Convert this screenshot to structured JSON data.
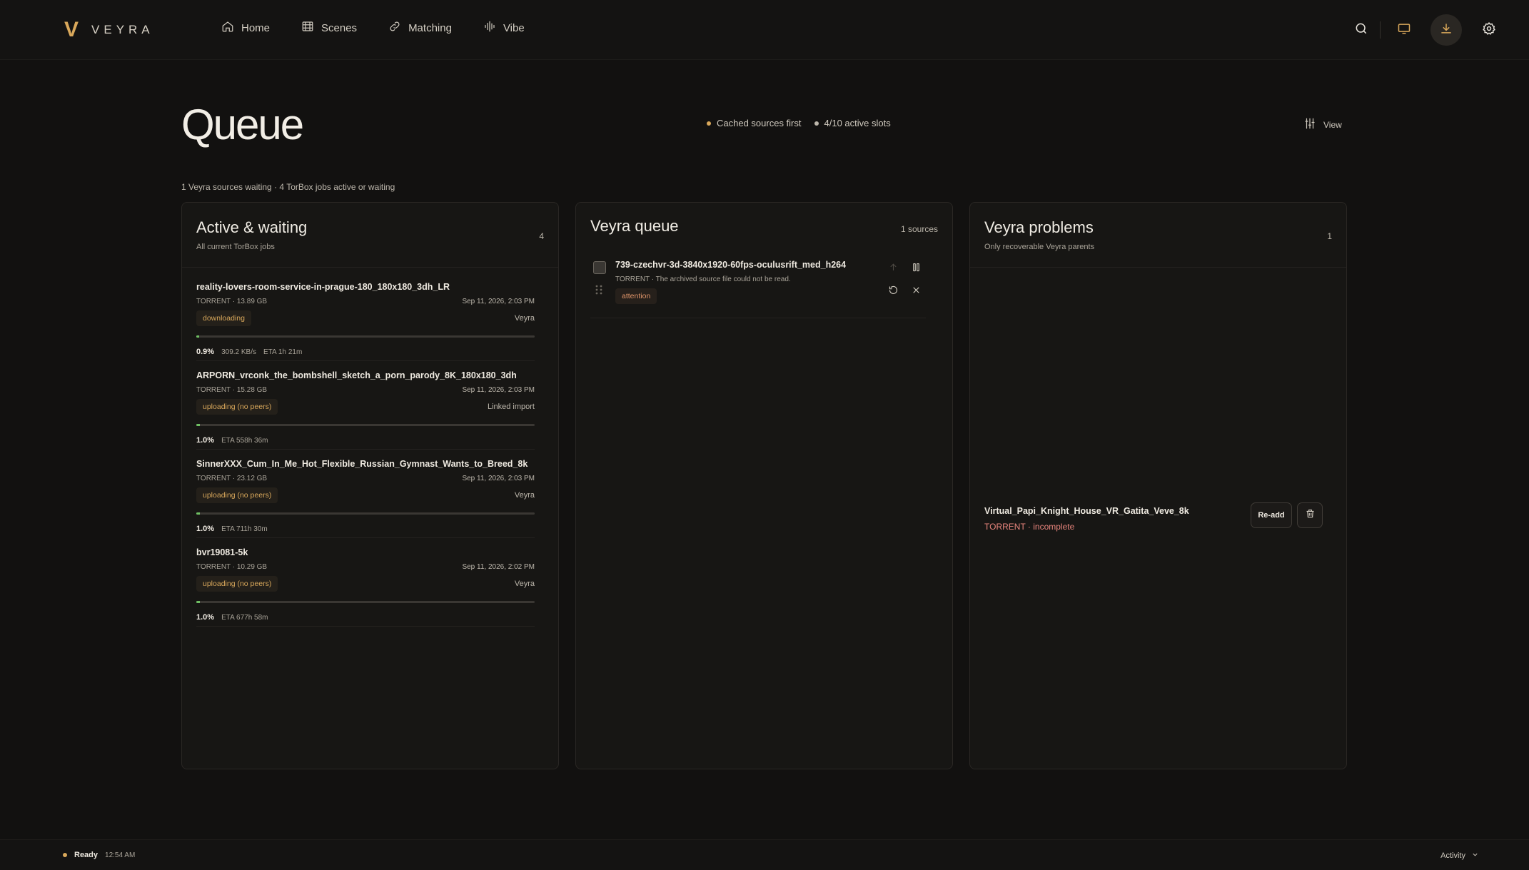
{
  "brand": {
    "mark": "V",
    "name": "VEYRA"
  },
  "nav": {
    "items": [
      {
        "label": "Home",
        "icon": "home-icon"
      },
      {
        "label": "Scenes",
        "icon": "film-icon"
      },
      {
        "label": "Matching",
        "icon": "link-icon"
      },
      {
        "label": "Vibe",
        "icon": "waveform-icon"
      }
    ]
  },
  "top_actions": [
    "search-icon",
    "monitor-icon",
    "download-icon",
    "gear-icon"
  ],
  "header": {
    "title": "Queue",
    "pills": [
      "Cached sources first",
      "4/10 active slots"
    ],
    "view_label": "View",
    "summary": "1 Veyra sources waiting · 4 TorBox jobs active or waiting"
  },
  "active_panel": {
    "title": "Active & waiting",
    "subtitle": "All current TorBox jobs",
    "count": "4",
    "jobs": [
      {
        "name": "reality-lovers-room-service-in-prague-180_180x180_3dh_LR",
        "meta": "TORRENT · 13.89 GB",
        "date": "Sep 11, 2026, 2:03 PM",
        "status": "downloading",
        "source": "Veyra",
        "progress": 0.009,
        "pct": "0.9%",
        "speed": "309.2 KB/s",
        "eta": "ETA 1h 21m"
      },
      {
        "name": "ARPORN_vrconk_the_bombshell_sketch_a_porn_parody_8K_180x180_3dh",
        "meta": "TORRENT · 15.28 GB",
        "date": "Sep 11, 2026, 2:03 PM",
        "status": "uploading (no peers)",
        "source": "Linked import",
        "progress": 0.01,
        "pct": "1.0%",
        "speed": "",
        "eta": "ETA 558h 36m"
      },
      {
        "name": "SinnerXXX_Cum_In_Me_Hot_Flexible_Russian_Gymnast_Wants_to_Breed_8k",
        "meta": "TORRENT · 23.12 GB",
        "date": "Sep 11, 2026, 2:03 PM",
        "status": "uploading (no peers)",
        "source": "Veyra",
        "progress": 0.01,
        "pct": "1.0%",
        "speed": "",
        "eta": "ETA 711h 30m"
      },
      {
        "name": "bvr19081-5k",
        "meta": "TORRENT · 10.29 GB",
        "date": "Sep 11, 2026, 2:02 PM",
        "status": "uploading (no peers)",
        "source": "Veyra",
        "progress": 0.01,
        "pct": "1.0%",
        "speed": "",
        "eta": "ETA 677h 58m"
      }
    ]
  },
  "queue_panel": {
    "title": "Veyra queue",
    "count": "1 sources",
    "items": [
      {
        "name": "739-czechvr-3d-3840x1920-60fps-oculusrift_med_h264",
        "meta": "TORRENT · The archived source file could not be read.",
        "badge": "attention"
      }
    ]
  },
  "problems_panel": {
    "title": "Veyra problems",
    "subtitle": "Only recoverable Veyra parents",
    "count": "1",
    "items": [
      {
        "name": "Virtual_Papi_Knight_House_VR_Gatita_Veve_8k",
        "meta": "TORRENT · incomplete",
        "readd_label": "Re-add"
      }
    ]
  },
  "footer": {
    "status": "Ready",
    "time": "12:54 AM",
    "activity": "Activity"
  },
  "colors": {
    "accent": "#d9a85b",
    "progress": "#6fbf63",
    "error": "#e8857d",
    "background": "#121110"
  }
}
